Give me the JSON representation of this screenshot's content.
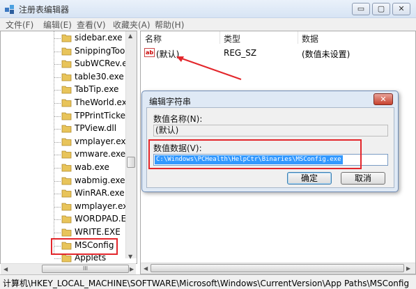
{
  "window": {
    "title": "注册表编辑器",
    "minimize": "▭",
    "maximize": "▢",
    "close": "✕"
  },
  "menu": [
    "文件(F)",
    "编辑(E)",
    "查看(V)",
    "收藏夹(A)",
    "帮助(H)"
  ],
  "tree": {
    "items": [
      "sidebar.exe",
      "SnippingTool",
      "SubWCRev.ex",
      "table30.exe",
      "TabTip.exe",
      "TheWorld.exe",
      "TPPrintTicket.",
      "TPView.dll",
      "vmplayer.exe",
      "vmware.exe",
      "wab.exe",
      "wabmig.exe",
      "WinRAR.exe",
      "wmplayer.exe",
      "WORDPAD.EX",
      "WRITE.EXE",
      "MSConfig",
      "Applets"
    ],
    "scroll_thumb_label": "III"
  },
  "list": {
    "columns": [
      "名称",
      "类型",
      "数据"
    ],
    "rows": [
      {
        "name": "(默认)",
        "type": "REG_SZ",
        "data": "(数值未设置)"
      }
    ],
    "icon_label": "ab"
  },
  "dialog": {
    "title": "编辑字符串",
    "name_label": "数值名称(N):",
    "name_value": "(默认)",
    "data_label": "数值数据(V):",
    "data_value": "C:\\Windows\\PCHealth\\HelpCtr\\Binaries\\MSConfig.exe",
    "ok": "确定",
    "cancel": "取消",
    "close": "✕"
  },
  "status": {
    "path": "计算机\\HKEY_LOCAL_MACHINE\\SOFTWARE\\Microsoft\\Windows\\CurrentVersion\\App Paths\\MSConfig"
  },
  "colors": {
    "highlight_box": "#e3262b",
    "selection": "#3399ff",
    "folder": "#e8c45a"
  }
}
